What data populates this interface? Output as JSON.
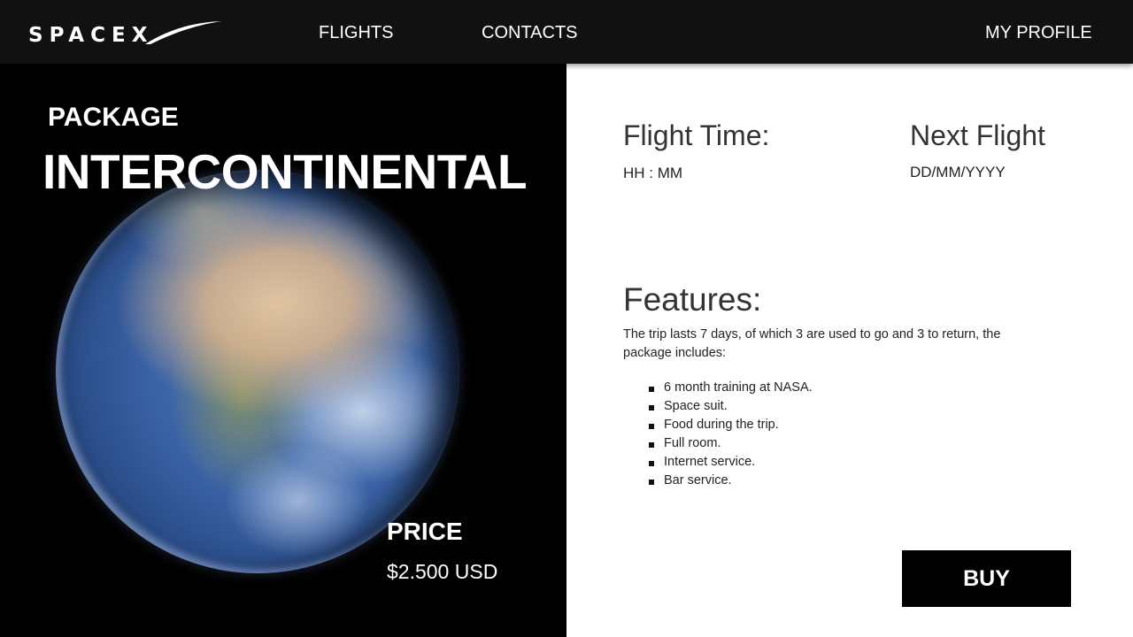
{
  "header": {
    "logo_text": "SPACEX",
    "nav": {
      "flights": "FLIGHTS",
      "contacts": "CONTACTS",
      "profile": "MY PROFILE"
    }
  },
  "package": {
    "label": "PACKAGE",
    "name": "INTERCONTINENTAL",
    "price_label": "PRICE",
    "price_value": "$2.500 USD"
  },
  "flight_info": {
    "flight_time_label": "Flight Time:",
    "flight_time_value": "HH : MM",
    "next_flight_label": "Next Flight",
    "next_flight_value": "DD/MM/YYYY"
  },
  "features": {
    "title": "Features:",
    "description": "The trip lasts 7 days, of which 3 are used to go and 3 to return, the package includes:",
    "items": [
      "6 month training at NASA.",
      "Space suit.",
      "Food during the trip.",
      "Full room.",
      "Internet service.",
      "Bar service."
    ]
  },
  "actions": {
    "buy_label": "BUY"
  },
  "colors": {
    "header_bg": "#111111",
    "panel_left_bg": "#000000",
    "panel_right_bg": "#ffffff",
    "button_bg": "#000000"
  }
}
